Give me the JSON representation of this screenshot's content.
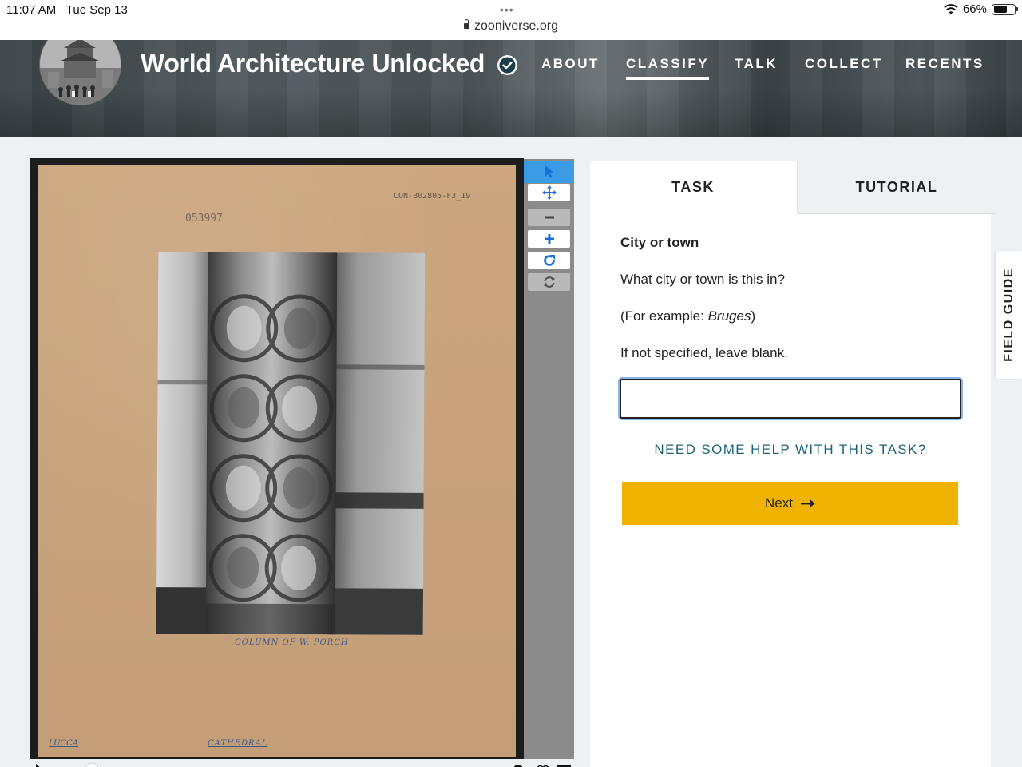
{
  "status_bar": {
    "time": "11:07 AM",
    "date": "Tue Sep 13",
    "url": "zooniverse.org",
    "battery": "66%",
    "battery_level": 0.66
  },
  "header": {
    "project_title": "World Architecture Unlocked",
    "nav": [
      {
        "label": "ABOUT"
      },
      {
        "label": "CLASSIFY",
        "active": true
      },
      {
        "label": "TALK"
      },
      {
        "label": "COLLECT"
      },
      {
        "label": "RECENTS"
      }
    ]
  },
  "subject": {
    "catalog_code": "CON-B02805-F3_19",
    "accession_number": "053997",
    "caption_center": "COLUMN OF W. PORCH",
    "caption_left": "LUCCA",
    "caption_right": "CATHEDRAL"
  },
  "tools": [
    {
      "name": "pointer-tool-icon"
    },
    {
      "name": "move-tool-icon"
    },
    {
      "name": "zoom-out-icon"
    },
    {
      "name": "zoom-in-icon"
    },
    {
      "name": "rotate-icon"
    },
    {
      "name": "reset-icon"
    }
  ],
  "task_panel": {
    "tabs": [
      {
        "label": "TASK"
      },
      {
        "label": "TUTORIAL"
      }
    ],
    "task_title": "City or town",
    "question": "What city or town is this in?",
    "example_prefix": "(For example: ",
    "example_value": "Bruges",
    "example_suffix": ")",
    "instruction": "If not specified, leave blank.",
    "answer_value": "",
    "help_link": "NEED SOME HELP WITH THIS TASK?",
    "next_label": "Next"
  },
  "field_guide_label": "FIELD GUIDE",
  "colors": {
    "accent_yellow": "#efb200",
    "help_link_teal": "#1c6377",
    "tool_selected_blue": "#3b9be5"
  }
}
